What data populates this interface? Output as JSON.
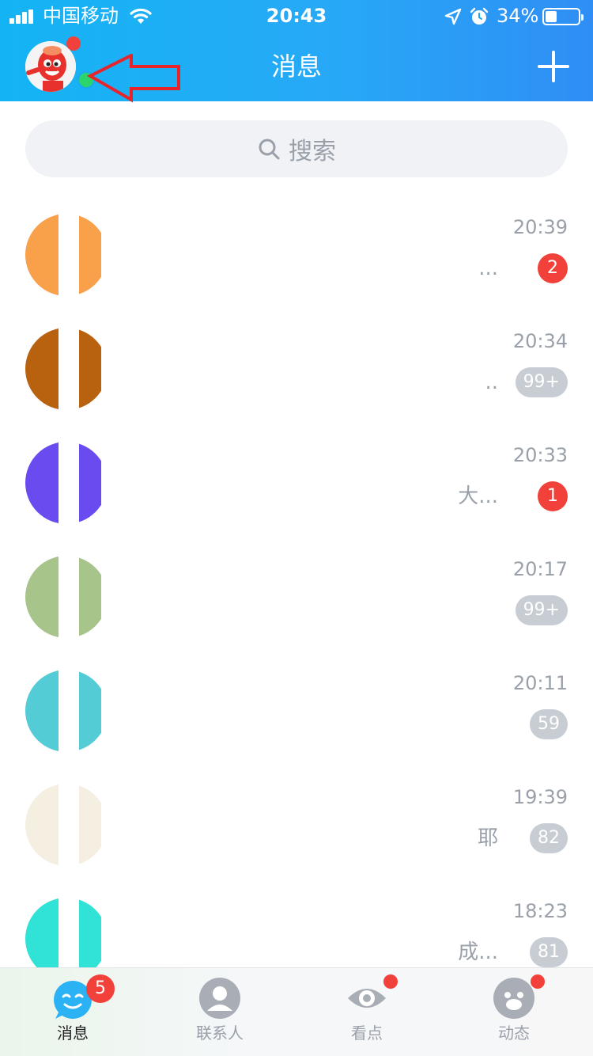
{
  "status_bar": {
    "carrier": "中国移动",
    "time": "20:43",
    "battery": "34%",
    "battery_level": 0.34
  },
  "header": {
    "title": "消息",
    "add_icon": "plus-icon"
  },
  "search": {
    "placeholder": "搜索",
    "icon": "search-icon"
  },
  "conversations": [
    {
      "time": "20:39",
      "snippet": "...",
      "badge": "2",
      "badge_style": "red",
      "avatar_color": "#f9a04b"
    },
    {
      "time": "20:34",
      "snippet": "..",
      "badge": "99+",
      "badge_style": "gray",
      "avatar_color": "#b8620f"
    },
    {
      "time": "20:33",
      "snippet": "大...",
      "badge": "1",
      "badge_style": "red",
      "avatar_color": "#6a4bf0"
    },
    {
      "time": "20:17",
      "snippet": "",
      "badge": "99+",
      "badge_style": "gray",
      "avatar_color": "#a7c48b"
    },
    {
      "time": "20:11",
      "snippet": "",
      "badge": "59",
      "badge_style": "gray",
      "avatar_color": "#54ccd6"
    },
    {
      "time": "19:39",
      "snippet": "耶",
      "badge": "82",
      "badge_style": "gray",
      "avatar_color": "#f5efe2"
    },
    {
      "time": "18:23",
      "snippet": "成...",
      "badge": "81",
      "badge_style": "gray",
      "avatar_color": "#31e3d6"
    }
  ],
  "tabs": [
    {
      "label": "消息",
      "icon": "message-icon",
      "badge": "5",
      "active": true
    },
    {
      "label": "联系人",
      "icon": "contacts-icon",
      "active": false
    },
    {
      "label": "看点",
      "icon": "eye-icon",
      "active": false,
      "dot": true
    },
    {
      "label": "动态",
      "icon": "trends-icon",
      "active": false,
      "dot": true
    }
  ],
  "colors": {
    "header_start": "#14b4f4",
    "header_end": "#2f8ef5",
    "badge_red": "#f2413a",
    "badge_gray": "#c8ccd3",
    "online_green": "#2bd56b"
  }
}
